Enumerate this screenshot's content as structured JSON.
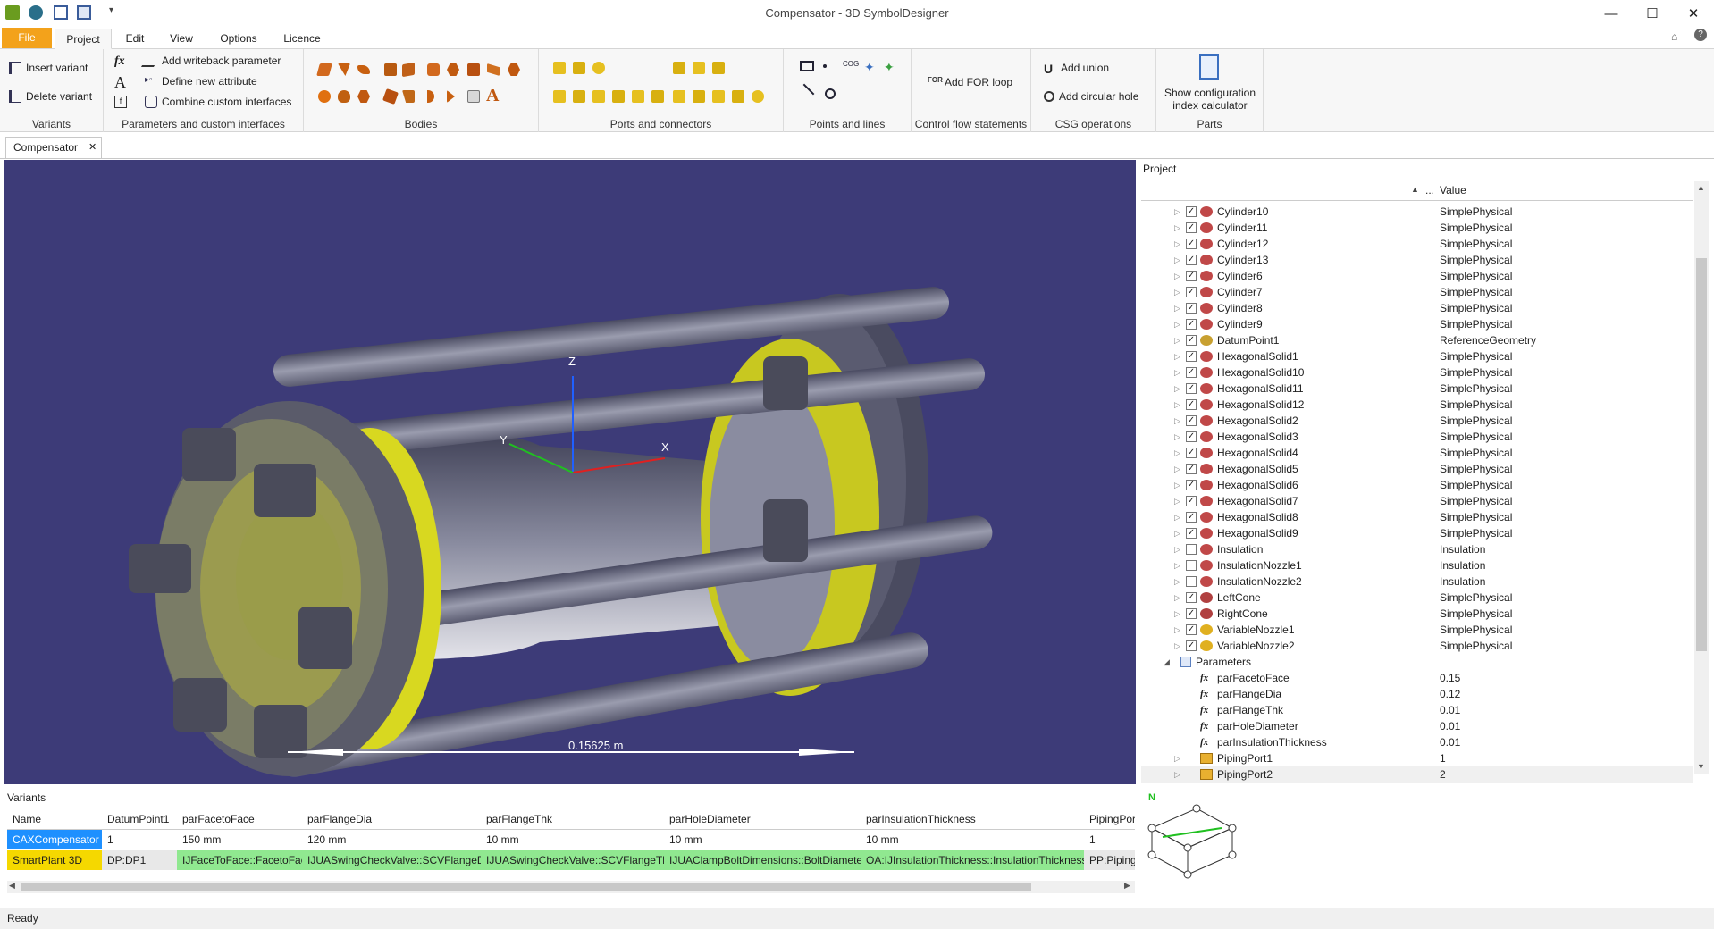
{
  "window": {
    "title": "Compensator - 3D SymbolDesigner"
  },
  "menu_tabs": [
    "File",
    "Project",
    "Edit",
    "View",
    "Options",
    "Licence"
  ],
  "ribbon": {
    "variants": {
      "label": "Variants",
      "insert": "Insert variant",
      "delete": "Delete variant"
    },
    "params": {
      "label": "Parameters and custom interfaces",
      "add_writeback": "Add writeback parameter",
      "define_attr": "Define new attribute",
      "combine": "Combine custom interfaces"
    },
    "bodies": {
      "label": "Bodies"
    },
    "ports": {
      "label": "Ports and connectors"
    },
    "points": {
      "label": "Points and lines"
    },
    "control": {
      "label": "Control flow statements",
      "add_for": "Add FOR loop"
    },
    "csg": {
      "label": "CSG operations",
      "union": "Add union",
      "hole": "Add circular hole"
    },
    "parts": {
      "label": "Parts",
      "show_calc": "Show configuration index calculator"
    }
  },
  "doc_tab": "Compensator",
  "viewport": {
    "axis_z": "Z",
    "axis_y": "Y",
    "axis_x": "X",
    "dimension": "0.15625 m"
  },
  "project_panel": {
    "title": "Project",
    "col_value": "Value",
    "col_dots": "...",
    "rows": [
      {
        "name": "Cylinder10",
        "value": "SimplePhysical",
        "checked": true,
        "icon": "cylinder-icon"
      },
      {
        "name": "Cylinder11",
        "value": "SimplePhysical",
        "checked": true,
        "icon": "cylinder-icon"
      },
      {
        "name": "Cylinder12",
        "value": "SimplePhysical",
        "checked": true,
        "icon": "cylinder-icon"
      },
      {
        "name": "Cylinder13",
        "value": "SimplePhysical",
        "checked": true,
        "icon": "cylinder-icon"
      },
      {
        "name": "Cylinder6",
        "value": "SimplePhysical",
        "checked": true,
        "icon": "cylinder-icon"
      },
      {
        "name": "Cylinder7",
        "value": "SimplePhysical",
        "checked": true,
        "icon": "cylinder-icon"
      },
      {
        "name": "Cylinder8",
        "value": "SimplePhysical",
        "checked": true,
        "icon": "cylinder-icon"
      },
      {
        "name": "Cylinder9",
        "value": "SimplePhysical",
        "checked": true,
        "icon": "cylinder-icon"
      },
      {
        "name": "DatumPoint1",
        "value": "ReferenceGeometry",
        "checked": true,
        "icon": "datum-point-icon"
      },
      {
        "name": "HexagonalSolid1",
        "value": "SimplePhysical",
        "checked": true,
        "icon": "hexagon-icon"
      },
      {
        "name": "HexagonalSolid10",
        "value": "SimplePhysical",
        "checked": true,
        "icon": "hexagon-icon"
      },
      {
        "name": "HexagonalSolid11",
        "value": "SimplePhysical",
        "checked": true,
        "icon": "hexagon-icon"
      },
      {
        "name": "HexagonalSolid12",
        "value": "SimplePhysical",
        "checked": true,
        "icon": "hexagon-icon"
      },
      {
        "name": "HexagonalSolid2",
        "value": "SimplePhysical",
        "checked": true,
        "icon": "hexagon-icon"
      },
      {
        "name": "HexagonalSolid3",
        "value": "SimplePhysical",
        "checked": true,
        "icon": "hexagon-icon"
      },
      {
        "name": "HexagonalSolid4",
        "value": "SimplePhysical",
        "checked": true,
        "icon": "hexagon-icon"
      },
      {
        "name": "HexagonalSolid5",
        "value": "SimplePhysical",
        "checked": true,
        "icon": "hexagon-icon"
      },
      {
        "name": "HexagonalSolid6",
        "value": "SimplePhysical",
        "checked": true,
        "icon": "hexagon-icon"
      },
      {
        "name": "HexagonalSolid7",
        "value": "SimplePhysical",
        "checked": true,
        "icon": "hexagon-icon"
      },
      {
        "name": "HexagonalSolid8",
        "value": "SimplePhysical",
        "checked": true,
        "icon": "hexagon-icon"
      },
      {
        "name": "HexagonalSolid9",
        "value": "SimplePhysical",
        "checked": true,
        "icon": "hexagon-icon"
      },
      {
        "name": "Insulation",
        "value": "Insulation",
        "checked": false,
        "icon": "cylinder-icon"
      },
      {
        "name": "InsulationNozzle1",
        "value": "Insulation",
        "checked": false,
        "icon": "cylinder-icon"
      },
      {
        "name": "InsulationNozzle2",
        "value": "Insulation",
        "checked": false,
        "icon": "cylinder-icon"
      },
      {
        "name": "LeftCone",
        "value": "SimplePhysical",
        "checked": true,
        "icon": "cone-icon"
      },
      {
        "name": "RightCone",
        "value": "SimplePhysical",
        "checked": true,
        "icon": "cone-icon"
      },
      {
        "name": "VariableNozzle1",
        "value": "SimplePhysical",
        "checked": true,
        "icon": "nozzle-icon"
      },
      {
        "name": "VariableNozzle2",
        "value": "SimplePhysical",
        "checked": true,
        "icon": "nozzle-icon"
      }
    ],
    "parameters_label": "Parameters",
    "parameters": [
      {
        "name": "parFacetoFace",
        "value": "0.15"
      },
      {
        "name": "parFlangeDia",
        "value": "0.12"
      },
      {
        "name": "parFlangeThk",
        "value": "0.01"
      },
      {
        "name": "parHoleDiameter",
        "value": "0.01"
      },
      {
        "name": "parInsulationThickness",
        "value": "0.01"
      }
    ],
    "ports": [
      {
        "name": "PipingPort1",
        "value": "1"
      },
      {
        "name": "PipingPort2",
        "value": "2"
      }
    ],
    "navcube_n": "N"
  },
  "variants_panel": {
    "title": "Variants",
    "headers": [
      "Name",
      "DatumPoint1",
      "parFacetoFace",
      "parFlangeDia",
      "parFlangeThk",
      "parHoleDiameter",
      "parInsulationThickness",
      "PipingPor"
    ],
    "row1": [
      "CAXCompensator",
      "1",
      "150 mm",
      "120 mm",
      "10 mm",
      "10 mm",
      "10 mm",
      "1"
    ],
    "row2": [
      "SmartPlant 3D",
      "DP:DP1",
      "IJFaceToFace::FacetoFace",
      "IJUASwingCheckValve::SCVFlangeDia",
      "IJUASwingCheckValve::SCVFlangeThk",
      "IJUAClampBoltDimensions::BoltDiameter",
      "OA:IJInsulationThickness::InsulationThickness",
      "PP:PipingP"
    ]
  },
  "status": "Ready",
  "colors": {
    "file_tab": "#f3a21b",
    "viewport_bg": "#3d3b78",
    "cax_row": "#1e90ff",
    "sp3d_row": "#f5d800",
    "green_cell": "#90e890"
  }
}
